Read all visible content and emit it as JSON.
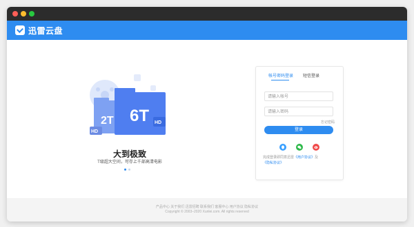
{
  "app": {
    "logo_text": "迅雷云盘"
  },
  "promo": {
    "badge_2t": "2T",
    "badge_6t": "6T",
    "badge_hd_left": "HD",
    "badge_hd_right": "HD",
    "title": "大到极致",
    "subtitle": "T级超大空间，可存上千部高清电影"
  },
  "login": {
    "tabs": [
      "帐号密码登录",
      "短信登录"
    ],
    "account_placeholder": "请输入帐号",
    "password_placeholder": "请输入密码",
    "forgot": "忘记密码",
    "submit": "登录",
    "agreement_prefix": "完成登录即同意迅雷",
    "user_agreement": "《用户协议》",
    "and": "及",
    "privacy_agreement": "《隐私协议》"
  },
  "footer": {
    "links": "产品中心  关于我们  迅雷招聘  联系我们  客服中心  用户协议  隐私协议",
    "copyright": "Copyright © 2003–2020 Xunlei.com. All rights reserved"
  },
  "colors": {
    "brand": "#2e8cf0",
    "wechat": "#2fb94b",
    "weibo": "#f04a4a",
    "qq": "#3aa0ff"
  }
}
